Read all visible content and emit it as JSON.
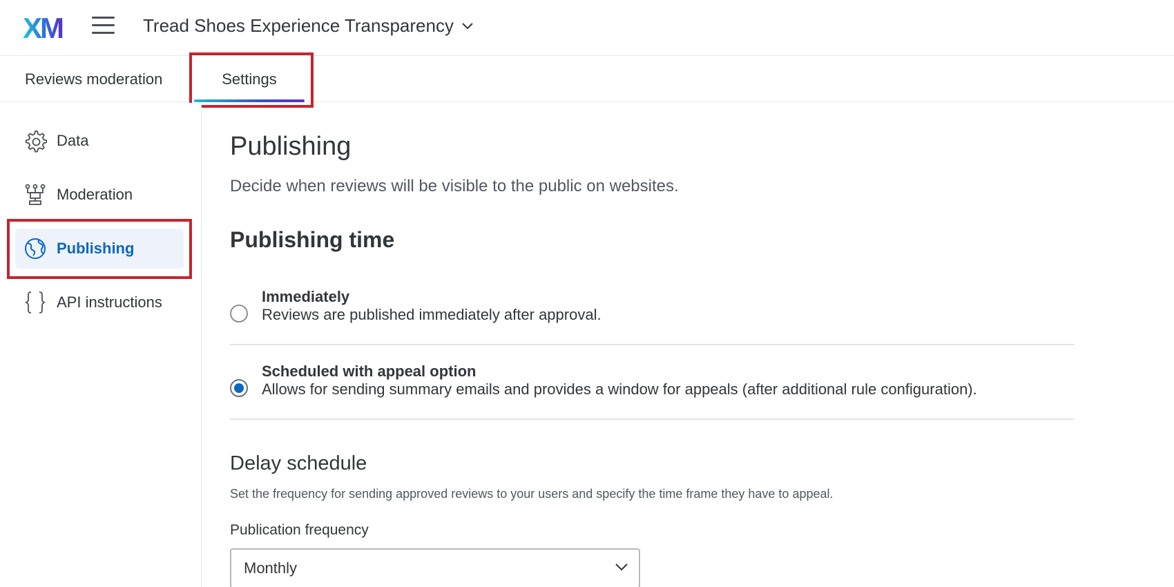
{
  "header": {
    "logo_text": "XM",
    "project_title": "Tread Shoes Experience Transparency"
  },
  "tabs": [
    {
      "label": "Reviews moderation",
      "active": false
    },
    {
      "label": "Settings",
      "active": true
    }
  ],
  "sidebar": {
    "items": [
      {
        "label": "Data",
        "icon": "gear-icon",
        "active": false
      },
      {
        "label": "Moderation",
        "icon": "moderation-icon",
        "active": false
      },
      {
        "label": "Publishing",
        "icon": "globe-icon",
        "active": true
      },
      {
        "label": "API instructions",
        "icon": "braces-icon",
        "active": false
      }
    ]
  },
  "main": {
    "title": "Publishing",
    "description": "Decide when reviews will be visible to the public on websites.",
    "section_title": "Publishing time",
    "options": [
      {
        "label": "Immediately",
        "description": "Reviews are published immediately after approval.",
        "selected": false
      },
      {
        "label": "Scheduled with appeal option",
        "description": "Allows for sending summary emails and provides a window for appeals (after additional rule configuration).",
        "selected": true
      }
    ],
    "delay": {
      "title": "Delay schedule",
      "description": "Set the frequency for sending approved reviews to your users and specify the time frame they have to appeal.",
      "frequency_label": "Publication frequency",
      "frequency_value": "Monthly"
    }
  },
  "colors": {
    "accent": "#0b67c2",
    "highlight": "#c4252f",
    "active_bg": "#eef3fb"
  }
}
